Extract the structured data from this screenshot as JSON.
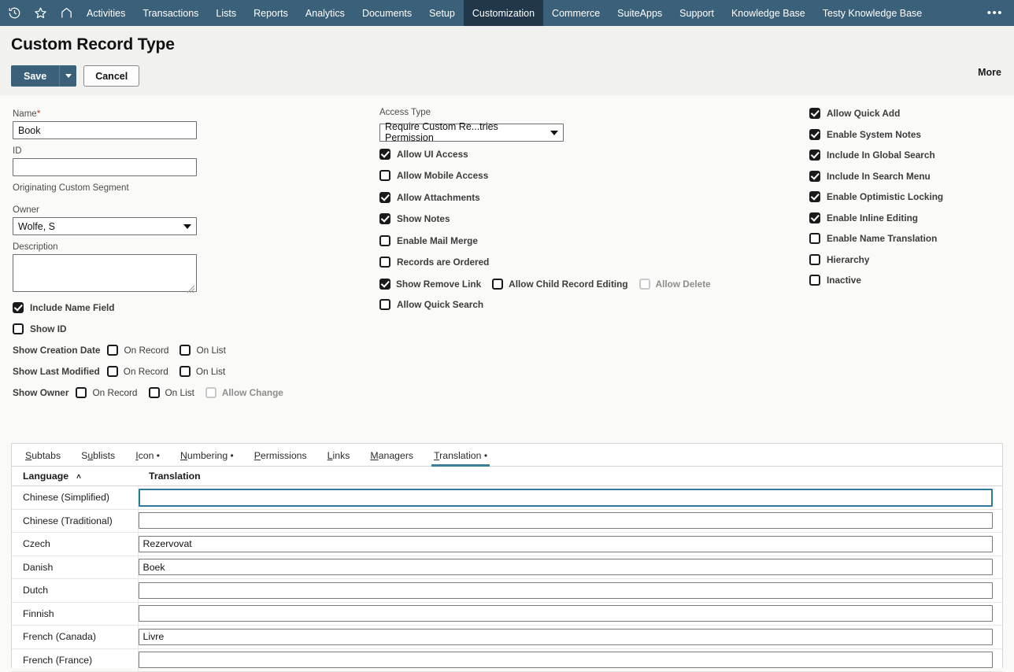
{
  "nav": {
    "icons": [
      {
        "name": "recent-history-icon"
      },
      {
        "name": "favorites-star-icon"
      },
      {
        "name": "home-icon"
      }
    ],
    "items": [
      {
        "label": "Activities",
        "active": false
      },
      {
        "label": "Transactions",
        "active": false
      },
      {
        "label": "Lists",
        "active": false
      },
      {
        "label": "Reports",
        "active": false
      },
      {
        "label": "Analytics",
        "active": false
      },
      {
        "label": "Documents",
        "active": false
      },
      {
        "label": "Setup",
        "active": false
      },
      {
        "label": "Customization",
        "active": true
      },
      {
        "label": "Commerce",
        "active": false
      },
      {
        "label": "SuiteApps",
        "active": false
      },
      {
        "label": "Support",
        "active": false
      },
      {
        "label": "Knowledge Base",
        "active": false
      },
      {
        "label": "Testy Knowledge Base",
        "active": false
      }
    ],
    "overflow_label": "•••",
    "bg_color": "#3b6079",
    "active_bg_color": "#22384a"
  },
  "header": {
    "title": "Custom Record Type",
    "more_label": "More",
    "save_label": "Save",
    "cancel_label": "Cancel",
    "save_color": "#3b6079"
  },
  "form": {
    "left": {
      "name_label": "Name",
      "name_required": "*",
      "name_value": "Book",
      "id_label": "ID",
      "id_value": "",
      "originating_segment_label": "Originating Custom Segment",
      "owner_label": "Owner",
      "owner_value": "Wolfe, S",
      "description_label": "Description",
      "description_value": "",
      "include_name_field": {
        "label": "Include Name Field",
        "checked": true
      },
      "show_id": {
        "label": "Show ID",
        "checked": false
      },
      "show_creation_date": {
        "label": "Show Creation Date",
        "options": [
          {
            "label": "On Record",
            "checked": false
          },
          {
            "label": "On List",
            "checked": false
          }
        ]
      },
      "show_last_modified": {
        "label": "Show Last Modified",
        "options": [
          {
            "label": "On Record",
            "checked": false
          },
          {
            "label": "On List",
            "checked": false
          }
        ]
      },
      "show_owner": {
        "label": "Show Owner",
        "options": [
          {
            "label": "On Record",
            "checked": false,
            "disabled": false
          },
          {
            "label": "On List",
            "checked": false,
            "disabled": false
          },
          {
            "label": "Allow Change",
            "checked": false,
            "disabled": true
          }
        ]
      }
    },
    "middle": {
      "access_type_label": "Access Type",
      "access_type_value": "Require Custom Re...tries Permission",
      "checks": [
        {
          "label": "Allow UI Access",
          "checked": true
        },
        {
          "label": "Allow Mobile Access",
          "checked": false
        },
        {
          "label": "Allow Attachments",
          "checked": true
        },
        {
          "label": "Show Notes",
          "checked": true
        },
        {
          "label": "Enable Mail Merge",
          "checked": false
        },
        {
          "label": "Records are Ordered",
          "checked": false
        }
      ],
      "remove_link_row": [
        {
          "label": "Show Remove Link",
          "checked": true,
          "disabled": false
        },
        {
          "label": "Allow Child Record Editing",
          "checked": false,
          "disabled": false
        },
        {
          "label": "Allow Delete",
          "checked": false,
          "disabled": true
        }
      ],
      "quick_search": {
        "label": "Allow Quick Search",
        "checked": false
      }
    },
    "right": {
      "checks": [
        {
          "label": "Allow Quick Add",
          "checked": true
        },
        {
          "label": "Enable System Notes",
          "checked": true
        },
        {
          "label": "Include In Global Search",
          "checked": true
        },
        {
          "label": "Include In Search Menu",
          "checked": true
        },
        {
          "label": "Enable Optimistic Locking",
          "checked": true
        },
        {
          "label": "Enable Inline Editing",
          "checked": true
        },
        {
          "label": "Enable Name Translation",
          "checked": false
        },
        {
          "label": "Hierarchy",
          "checked": false
        },
        {
          "label": "Inactive",
          "checked": false
        }
      ]
    }
  },
  "tabs": {
    "active_underline_color": "#3b7f99",
    "items": [
      {
        "label": "Subtabs",
        "accesskey": "S",
        "marker": "",
        "active": false
      },
      {
        "label": "Sublists",
        "accesskey": "u",
        "marker": "",
        "active": false
      },
      {
        "label": "Icon",
        "accesskey": "I",
        "marker": "•",
        "active": false
      },
      {
        "label": "Numbering",
        "accesskey": "N",
        "marker": "•",
        "active": false
      },
      {
        "label": "Permissions",
        "accesskey": "P",
        "marker": "",
        "active": false
      },
      {
        "label": "Links",
        "accesskey": "L",
        "marker": "",
        "active": false
      },
      {
        "label": "Managers",
        "accesskey": "M",
        "marker": "",
        "active": false
      },
      {
        "label": "Translation",
        "accesskey": "T",
        "marker": "•",
        "active": true
      }
    ]
  },
  "translation_table": {
    "columns": [
      {
        "label": "Language",
        "sort": "asc",
        "sort_glyph": "˄"
      },
      {
        "label": "Translation"
      }
    ],
    "rows": [
      {
        "language": "Chinese (Simplified)",
        "translation": "",
        "focused": true
      },
      {
        "language": "Chinese (Traditional)",
        "translation": "",
        "focused": false
      },
      {
        "language": "Czech",
        "translation": "Rezervovat",
        "focused": false
      },
      {
        "language": "Danish",
        "translation": "Boek",
        "focused": false
      },
      {
        "language": "Dutch",
        "translation": "",
        "focused": false
      },
      {
        "language": "Finnish",
        "translation": "",
        "focused": false
      },
      {
        "language": "French (Canada)",
        "translation": "Livre",
        "focused": false
      },
      {
        "language": "French (France)",
        "translation": "",
        "focused": false
      }
    ]
  }
}
